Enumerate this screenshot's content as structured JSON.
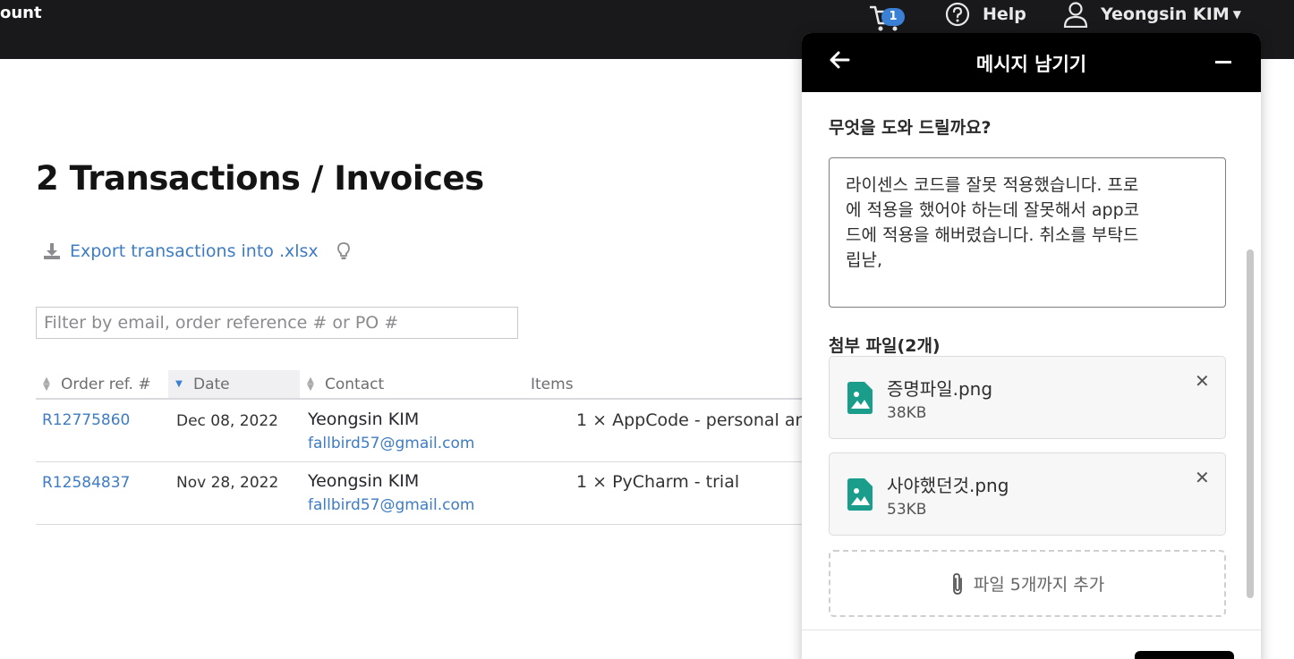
{
  "topbar": {
    "brand_fragment": "ount",
    "cart_count": "1",
    "help_label": "Help",
    "user_name": "Yeongsin KIM",
    "icons": [
      "cart-icon",
      "help-icon",
      "user-icon",
      "caret-down-icon"
    ]
  },
  "main": {
    "title": "2 Transactions / Invoices",
    "export_label": "Export transactions into .xlsx",
    "filter_placeholder": "Filter by email, order reference # or PO #",
    "columns": [
      "Order ref. #",
      "Date",
      "Contact",
      "Items"
    ],
    "sorted_column": "Date",
    "rows": [
      {
        "ref": "R12775860",
        "date": "Dec 08, 2022",
        "name": "Yeongsin KIM",
        "email": "fallbird57@gmail.com",
        "item": "1 × AppCode - personal an"
      },
      {
        "ref": "R12584837",
        "date": "Nov 28, 2022",
        "name": "Yeongsin KIM",
        "email": "fallbird57@gmail.com",
        "item": "1 × PyCharm - trial"
      }
    ]
  },
  "widget": {
    "title": "메시지 남기기",
    "question": "무엇을 도와 드릴까요?",
    "message_lines": [
      "라이센스 코드를 잘못 적용했습니다. 프로",
      "에 적용을 했어야 하는데 잘못해서 app코",
      "드에 적용을 해버렸습니다. 취소를 부탁드",
      "립낟,"
    ],
    "attachments_label": "첨부 파일(2개)",
    "files": [
      {
        "name": "증명파일.png",
        "size": "38KB"
      },
      {
        "name": "사야했던것.png",
        "size": "53KB"
      }
    ],
    "add_label": "파일 5개까지 추가"
  },
  "colors": {
    "accent": "#3e7cc4",
    "badge": "#3a80d6",
    "file_icon": "#1a9e8b",
    "topbar": "#19191c"
  }
}
